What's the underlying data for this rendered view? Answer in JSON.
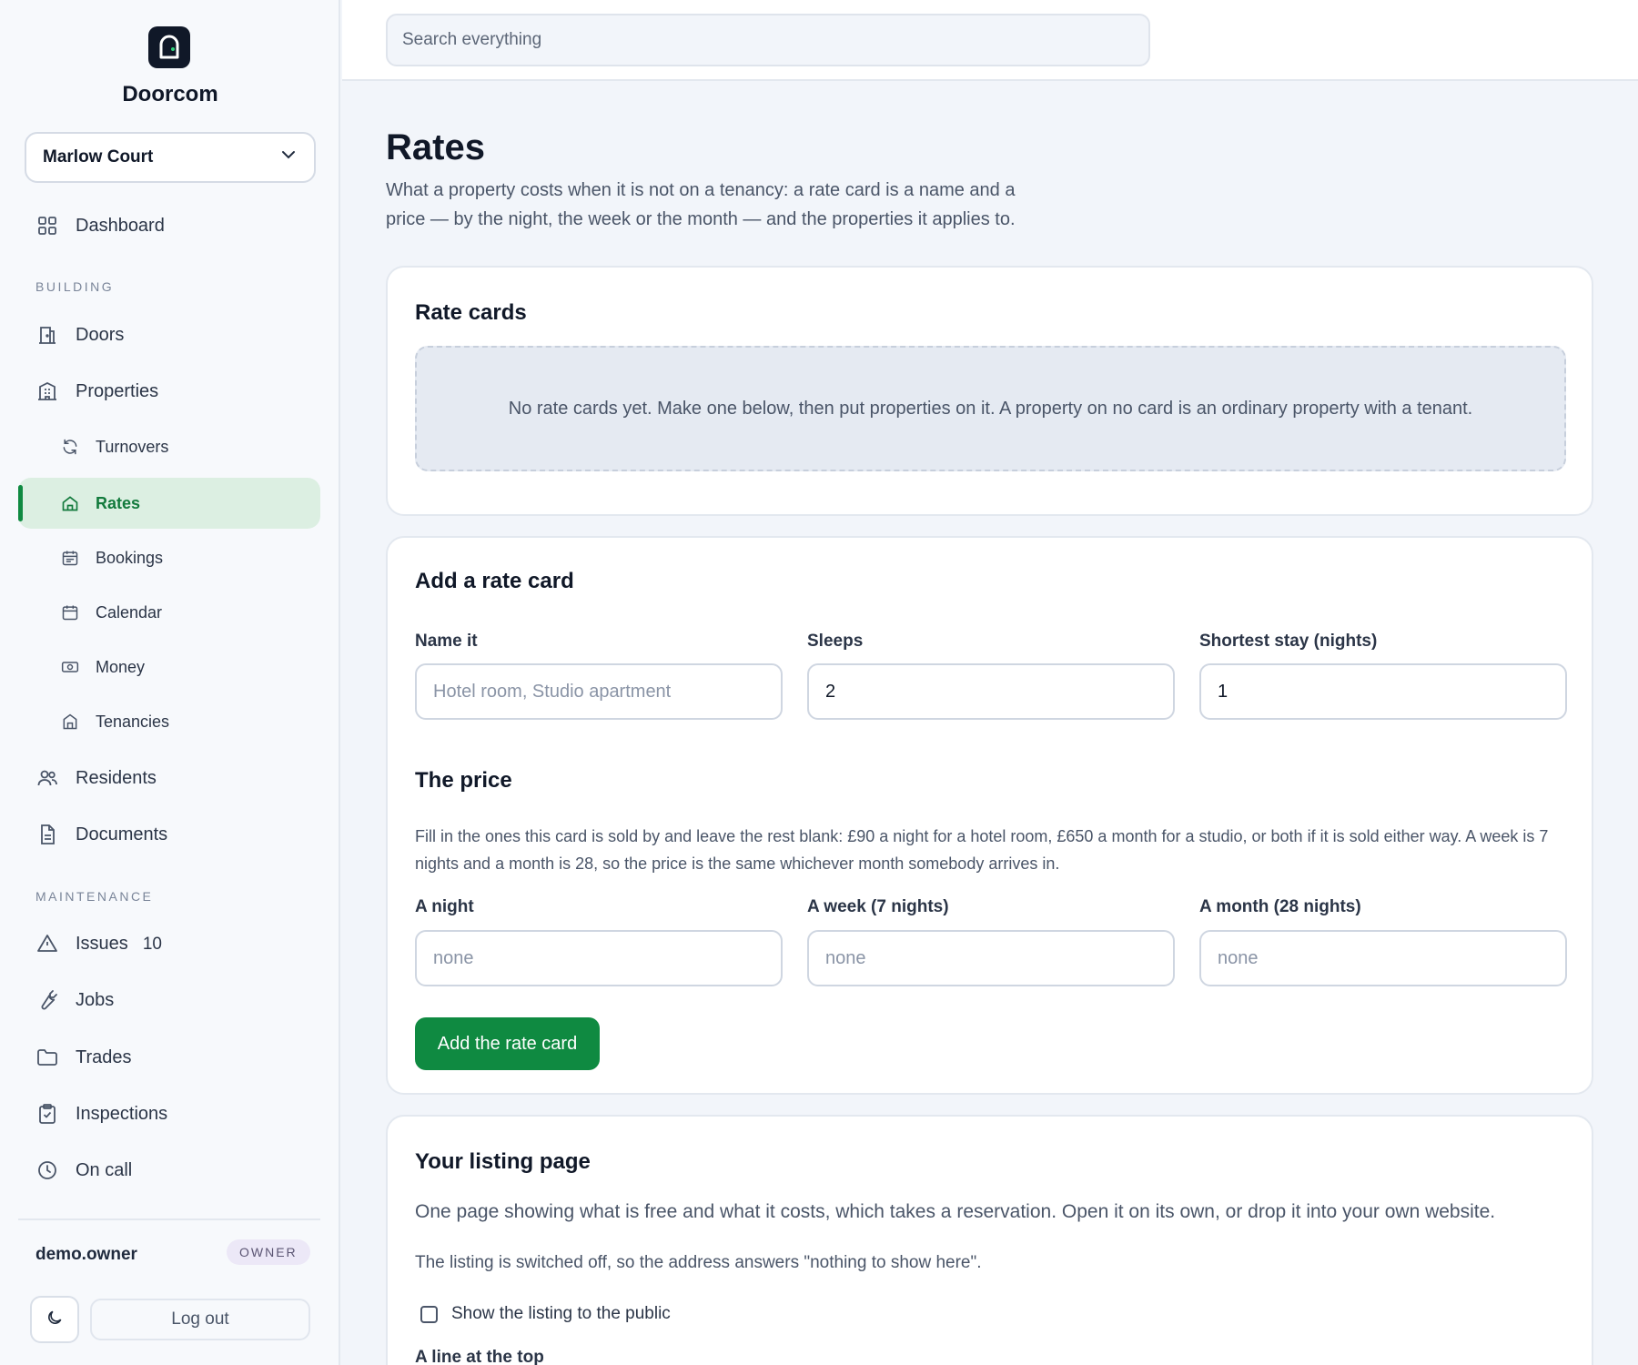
{
  "brand": {
    "name": "Doorcom",
    "logo_icon": "door-lock-icon"
  },
  "building_selector": {
    "value": "Marlow Court"
  },
  "sidebar": {
    "top": [
      {
        "label": "Dashboard",
        "icon": "grid-icon"
      }
    ],
    "sections": {
      "building": "BUILDING",
      "maintenance": "MAINTENANCE"
    },
    "building_items": [
      {
        "label": "Doors",
        "icon": "door-icon"
      },
      {
        "label": "Properties",
        "icon": "building-icon"
      },
      {
        "label": "Turnovers",
        "icon": "refresh-icon"
      },
      {
        "label": "Rates",
        "icon": "home-icon",
        "active": true
      },
      {
        "label": "Bookings",
        "icon": "calendar-list-icon"
      },
      {
        "label": "Calendar",
        "icon": "calendar-icon"
      },
      {
        "label": "Money",
        "icon": "banknote-icon"
      },
      {
        "label": "Tenancies",
        "icon": "house-icon"
      },
      {
        "label": "Residents",
        "icon": "users-icon"
      },
      {
        "label": "Documents",
        "icon": "file-icon"
      }
    ],
    "maintenance_items": [
      {
        "label": "Issues",
        "icon": "warning-icon",
        "count": "10"
      },
      {
        "label": "Jobs",
        "icon": "wrench-icon"
      },
      {
        "label": "Trades",
        "icon": "folder-icon"
      },
      {
        "label": "Inspections",
        "icon": "clipboard-check-icon"
      },
      {
        "label": "On call",
        "icon": "clock-icon"
      }
    ],
    "user": {
      "name": "demo.owner",
      "role": "OWNER"
    },
    "theme_toggle_icon": "moon-icon",
    "logout_label": "Log out"
  },
  "search": {
    "placeholder": "Search everything"
  },
  "page": {
    "title": "Rates",
    "description": "What a property costs when it is not on a tenancy: a rate card is a name and a price — by the night, the week or the month — and the properties it applies to."
  },
  "rate_cards": {
    "title": "Rate cards",
    "empty_text": "No rate cards yet. Make one below, then put properties on it. A property on no card is an ordinary property with a tenant."
  },
  "add_card": {
    "title": "Add a rate card",
    "fields": {
      "name": {
        "label": "Name it",
        "value": "",
        "placeholder": "Hotel room, Studio apartment"
      },
      "sleeps": {
        "label": "Sleeps",
        "value": "2"
      },
      "shortest": {
        "label": "Shortest stay (nights)",
        "value": "1"
      }
    },
    "price": {
      "title": "The price",
      "help": "Fill in the ones this card is sold by and leave the rest blank: £90 a night for a hotel room, £650 a month for a studio, or both if it is sold either way. A week is 7 nights and a month is 28, so the price is the same whichever month somebody arrives in.",
      "night": {
        "label": "A night",
        "placeholder": "none"
      },
      "week": {
        "label": "A week (7 nights)",
        "placeholder": "none"
      },
      "month": {
        "label": "A month (28 nights)",
        "placeholder": "none"
      }
    },
    "submit_label": "Add the rate card"
  },
  "listing": {
    "title": "Your listing page",
    "description": "One page showing what is free and what it costs, which takes a reservation. Open it on its own, or drop it into your own website.",
    "status": "The listing is switched off, so the address answers \"nothing to show here\".",
    "checkbox_label": "Show the listing to the public",
    "checkbox_checked": false,
    "next_label": "A line at the top"
  }
}
